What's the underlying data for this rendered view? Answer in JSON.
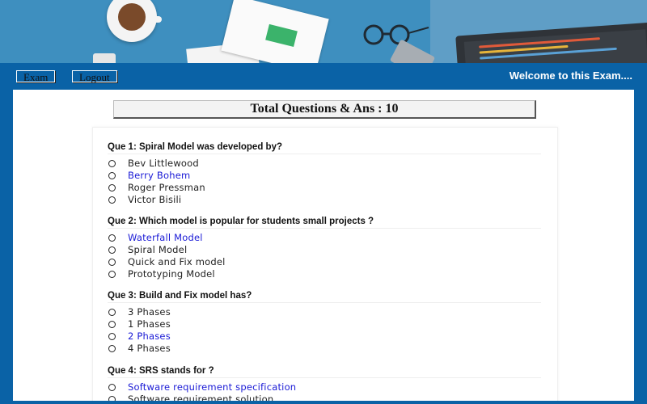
{
  "nav": {
    "exam_label": "Exam",
    "logout_label": "Logout",
    "welcome": "Welcome to this Exam...."
  },
  "header": {
    "total": "Total Questions & Ans : 10"
  },
  "questions": [
    {
      "title": "Que 1: Spiral Model was developed by?",
      "options": [
        {
          "text": "Bev Littlewood",
          "correct": false
        },
        {
          "text": "Berry Bohem",
          "correct": true
        },
        {
          "text": "Roger Pressman",
          "correct": false
        },
        {
          "text": "Victor Bisili",
          "correct": false
        }
      ]
    },
    {
      "title": "Que 2: Which model is popular for students small projects ?",
      "options": [
        {
          "text": "Waterfall Model",
          "correct": true
        },
        {
          "text": "Spiral Model",
          "correct": false
        },
        {
          "text": "Quick and Fix model",
          "correct": false
        },
        {
          "text": "Prototyping Model",
          "correct": false
        }
      ]
    },
    {
      "title": "Que 3: Build and Fix model has?",
      "options": [
        {
          "text": "3 Phases",
          "correct": false
        },
        {
          "text": "1 Phases",
          "correct": false
        },
        {
          "text": "2 Phases",
          "correct": true
        },
        {
          "text": "4 Phases",
          "correct": false
        }
      ]
    },
    {
      "title": "Que 4: SRS stands for ?",
      "options": [
        {
          "text": "Software requirement specification",
          "correct": true
        },
        {
          "text": "Software requirement solution",
          "correct": false
        }
      ]
    }
  ],
  "colors": {
    "nav_bg": "#0a62a6",
    "correct_answer": "#1a1ad6",
    "banner_bg": "#3e8fbf"
  }
}
